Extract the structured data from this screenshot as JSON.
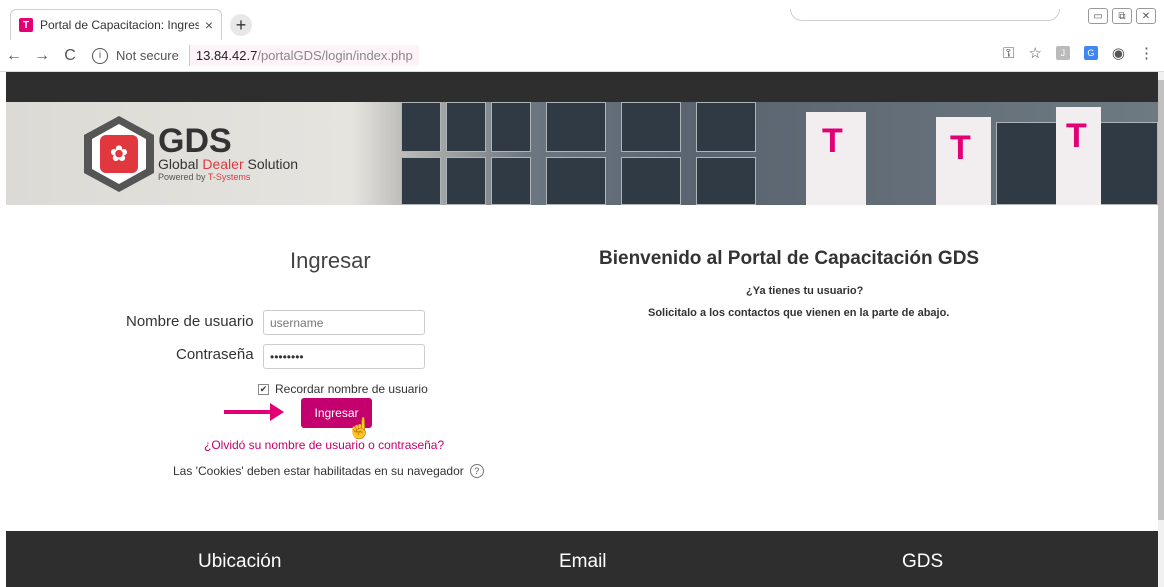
{
  "browser": {
    "tab_title": "Portal de Capacitacion: Ingresar a",
    "tab_close": "×",
    "new_tab": "+",
    "back": "←",
    "forward": "→",
    "reload": "C",
    "security_icon": "i",
    "security_text": "Not secure",
    "url_host": "13.84.42.7",
    "url_path": "/portalGDS/login/index.php"
  },
  "banner": {
    "logo_title": "GDS",
    "logo_sub_a": "Global ",
    "logo_sub_b": "Dealer",
    "logo_sub_c": " Solution",
    "logo_pow_a": "Powered by ",
    "logo_pow_b": "T-Systems"
  },
  "login": {
    "title": "Ingresar",
    "username_label": "Nombre de usuario",
    "username_value": "username",
    "password_label": "Contraseña",
    "password_value": "••••••••",
    "remember_label": "Recordar nombre de usuario",
    "submit_label": "Ingresar",
    "forgot_link": "¿Olvidó su nombre de usuario o contraseña?",
    "cookies_note": "Las 'Cookies' deben estar habilitadas en su navegador",
    "help_icon": "?"
  },
  "welcome": {
    "title": "Bienvenido al Portal de Capacitación GDS",
    "question": "¿Ya tienes tu usuario?",
    "instruction": "Solicitalo a los contactos que vienen en la parte de abajo."
  },
  "footer": {
    "col1": "Ubicación",
    "col2": "Email",
    "col3": "GDS"
  },
  "colors": {
    "accent": "#c4006f",
    "magenta": "#e20074",
    "footer_bg": "#2e2e2e"
  }
}
